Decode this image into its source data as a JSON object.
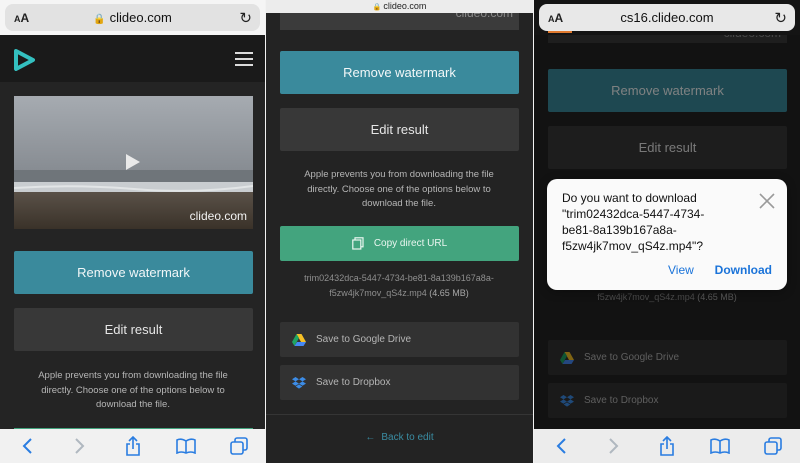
{
  "colors": {
    "teal": "#3a8a9c",
    "green": "#43a47e",
    "link_blue": "#1a73d9",
    "logo": "#34c0c0"
  },
  "browser": {
    "aa_label": "AA",
    "p1_url": "clideo.com",
    "p2_url": "clideo.com",
    "p3_url": "cs16.clideo.com"
  },
  "video": {
    "watermark": "clideo.com"
  },
  "buttons": {
    "remove_watermark": "Remove watermark",
    "edit_result": "Edit result",
    "copy_url": "Copy direct URL",
    "google_drive": "Save to Google Drive",
    "dropbox": "Save to Dropbox",
    "back_to_edit": "Back to edit"
  },
  "note_lines": [
    "Apple prevents you from downloading the file",
    "directly. Choose one of the options below to",
    "download the file."
  ],
  "file": {
    "name_line1": "trim02432dca-5447-4734-be81-8a139b167a8a-",
    "name_line2": "f5zw4jk7mov_qS4z.mp4",
    "size": "(4.65 MB)"
  },
  "dialog": {
    "line1": "Do you want to download",
    "line2": "\"trim02432dca-5447-4734-",
    "line3": "be81-8a139b167a8a-",
    "line4": "f5zw4jk7mov_qS4z.mp4\"?",
    "view": "View",
    "download": "Download"
  },
  "icons": [
    "lock-icon",
    "reload-icon",
    "clideo-logo-icon",
    "hamburger-menu-icon",
    "play-icon",
    "copy-icon",
    "google-drive-icon",
    "dropbox-icon",
    "arrow-left-icon",
    "back-icon",
    "forward-icon",
    "share-icon",
    "bookmarks-icon",
    "tabs-icon",
    "close-icon"
  ]
}
